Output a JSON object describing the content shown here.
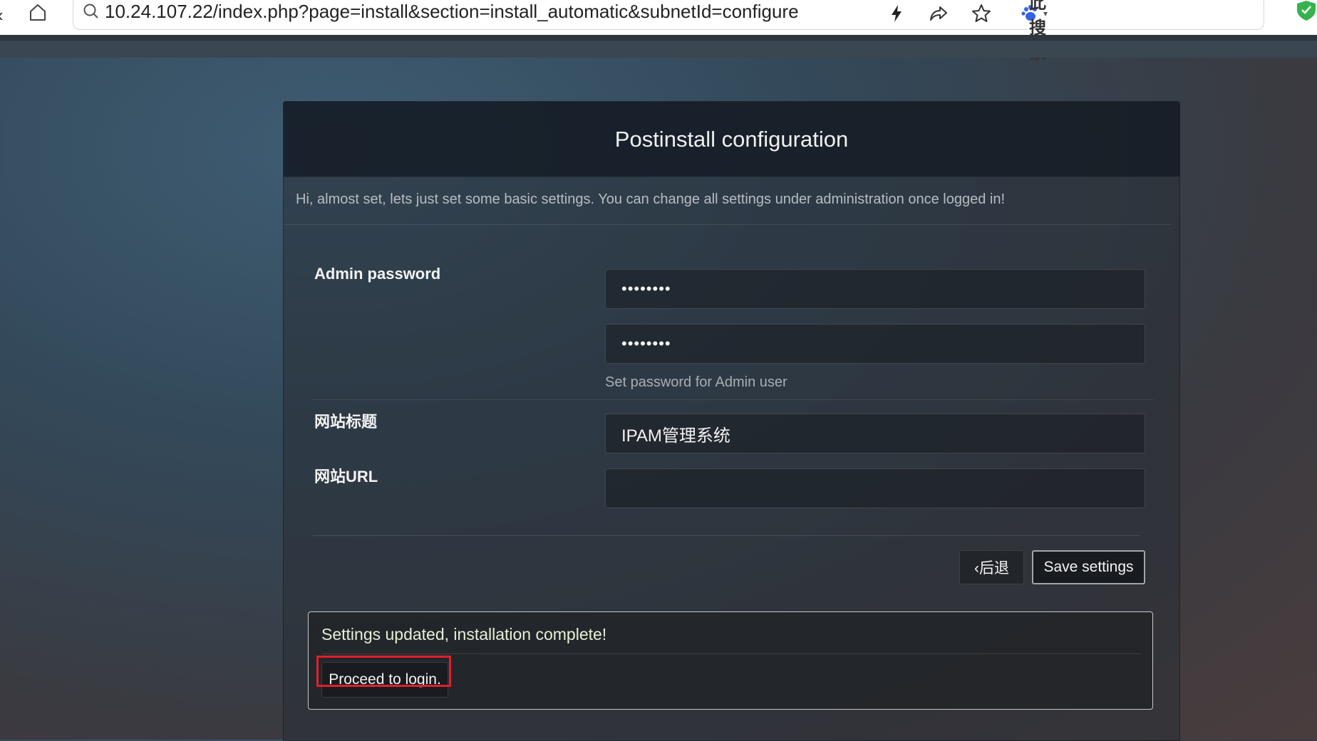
{
  "browser": {
    "url": "10.24.107.22/index.php?page=install&section=install_automatic&subnetId=configure",
    "search_engine_label": "在此搜索",
    "icons": [
      "back-icon",
      "home-icon",
      "search-icon",
      "lightning-icon",
      "share-icon",
      "star-icon",
      "paw-icon",
      "shield-icon"
    ]
  },
  "panel": {
    "title": "Postinstall configuration",
    "intro": "Hi, almost set, lets just set some basic settings. You can change all settings under administration once logged in!"
  },
  "form": {
    "admin_password_label": "Admin password",
    "password_value": "••••••••",
    "password_confirm_value": "••••••••",
    "password_hint": "Set password for Admin user",
    "site_title_label": "网站标题",
    "site_title_value": "IPAM管理系统",
    "site_url_label": "网站URL",
    "site_url_value": "",
    "back_button": "‹后退",
    "save_button": "Save settings"
  },
  "alert": {
    "message": "Settings updated, installation complete!",
    "login_button": "Proceed to login."
  },
  "colors": {
    "highlight_border": "#e0202a",
    "alert_text": "#e6f0d6"
  }
}
